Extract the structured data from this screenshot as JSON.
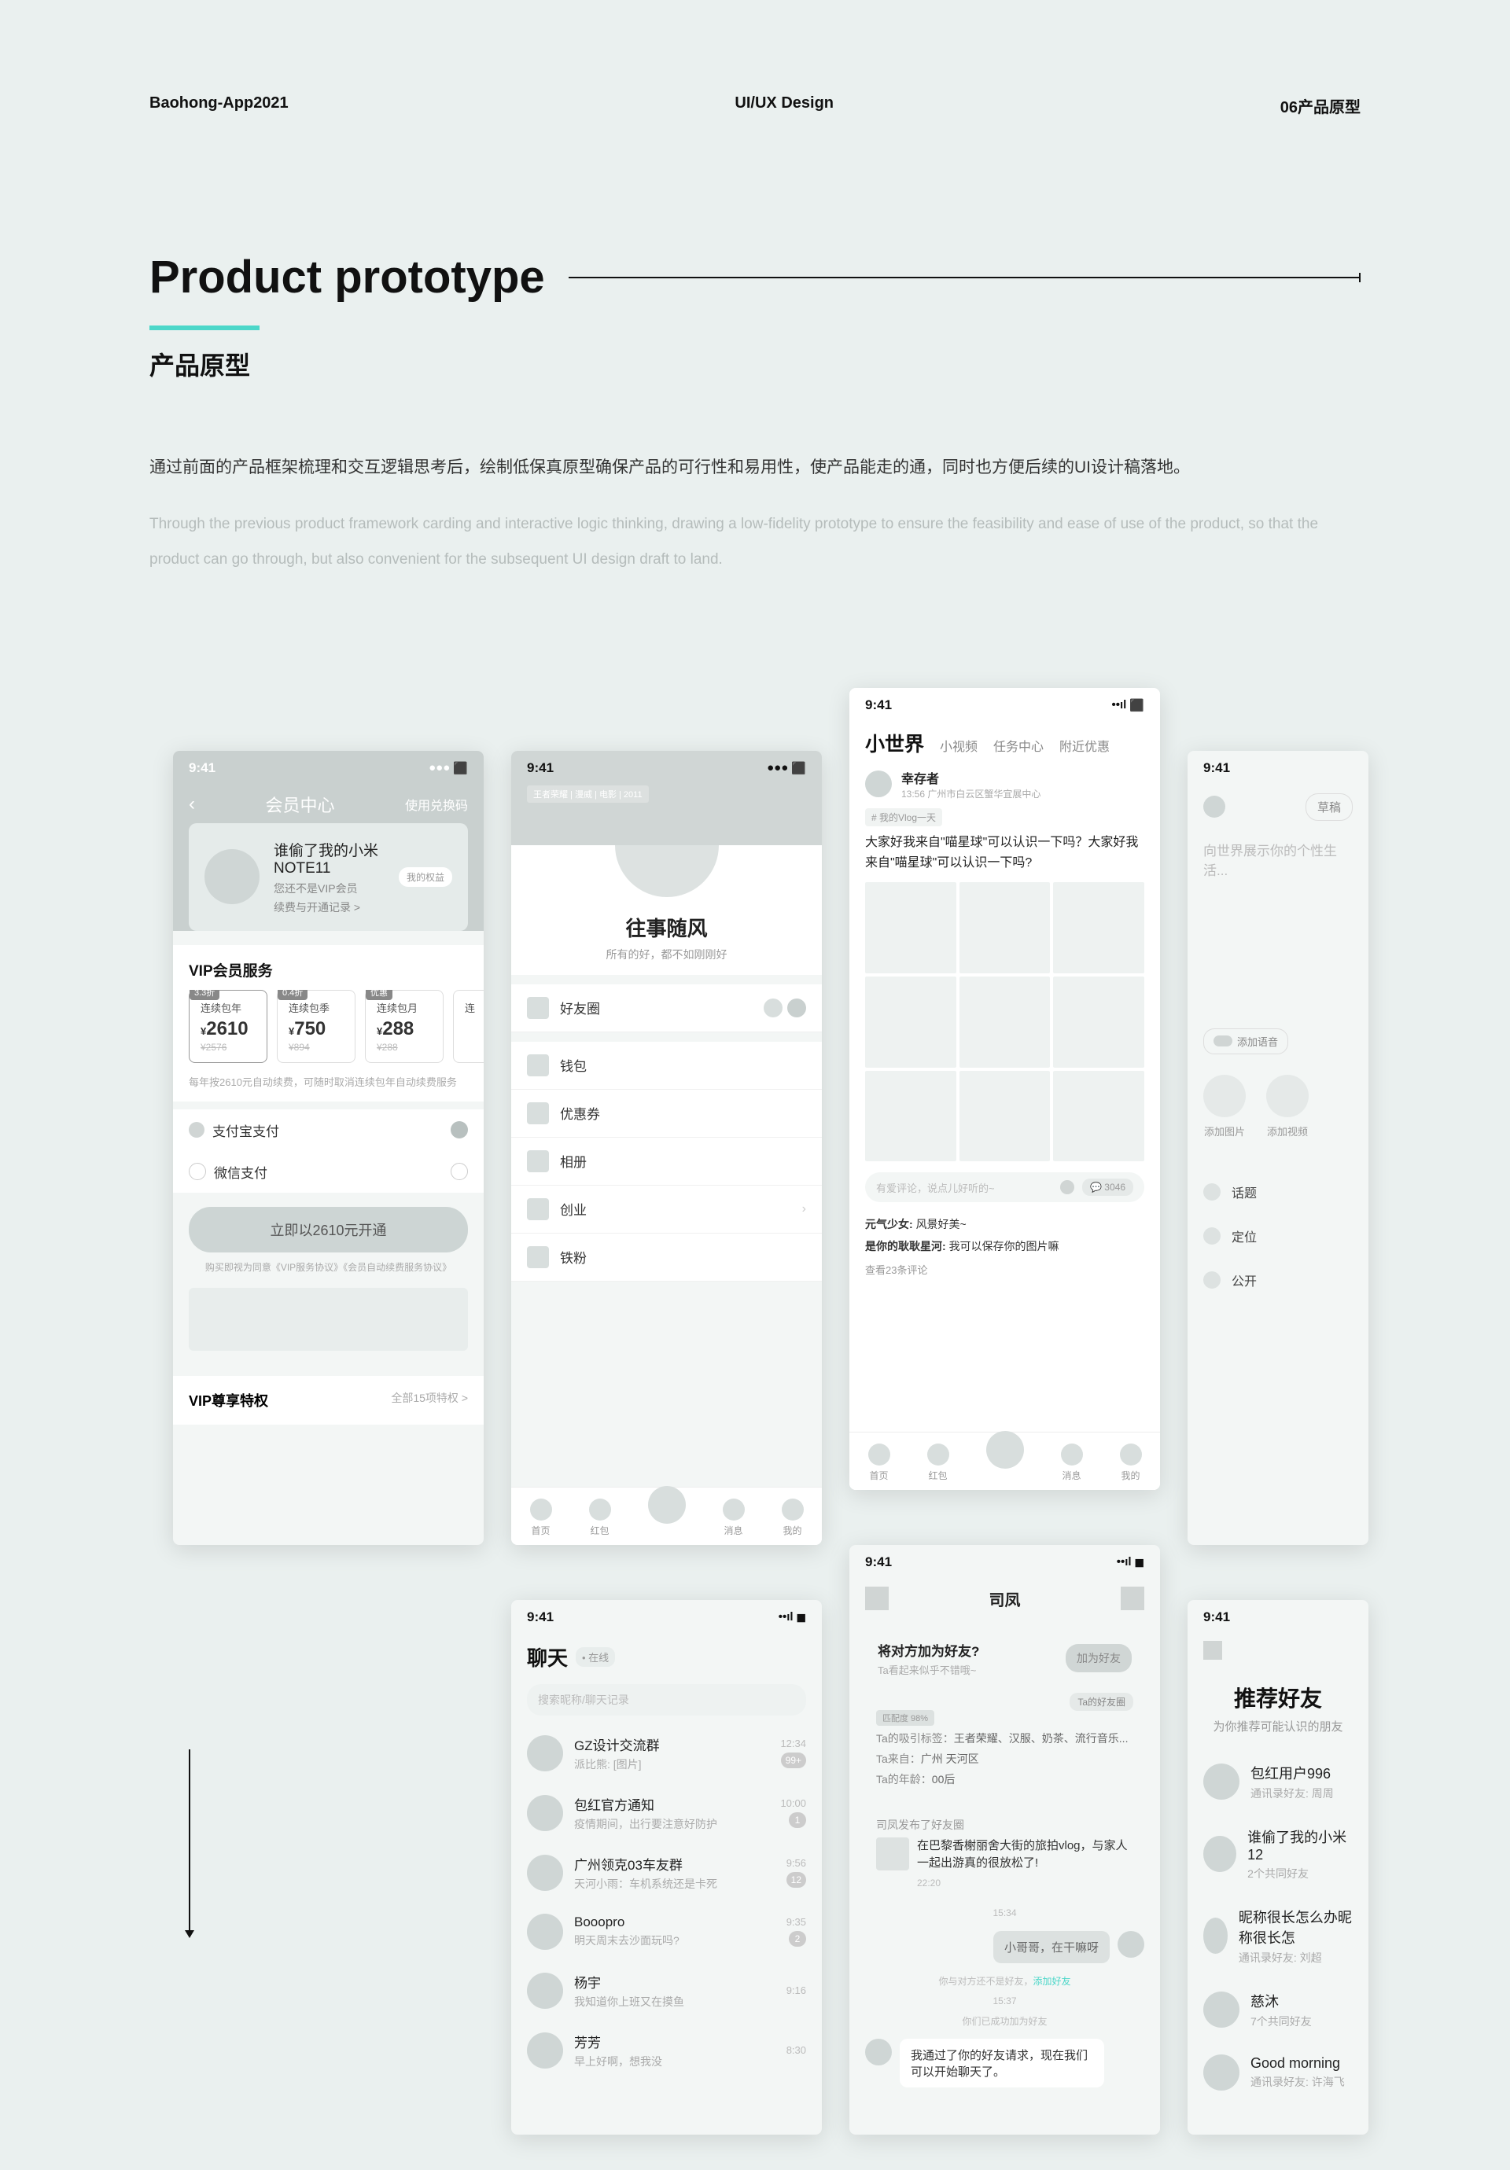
{
  "header": {
    "left": "Baohong-App2021",
    "center": "UI/UX Design",
    "right": "06产品原型"
  },
  "title": "Product prototype",
  "subtitle": "产品原型",
  "desc_cn": "通过前面的产品框架梳理和交互逻辑思考后，绘制低保真原型确保产品的可行性和易用性，使产品能走的通，同时也方便后续的UI设计稿落地。",
  "desc_en": "Through the previous product framework carding and interactive logic thinking, drawing a low-fidelity prototype to ensure the feasibility and ease of use of the product, so that the product can go through, but also convenient for the subsequent UI design draft to land.",
  "time": "9:41",
  "vip": {
    "nav_title": "会员中心",
    "nav_right": "使用兑换码",
    "uname": "谁偷了我的小米NOTE11",
    "usub": "您还不是VIP会员",
    "ulink": "续费与开通记录 >",
    "pill": "我的权益",
    "section": "VIP会员服务",
    "plans": [
      {
        "tag": "3.3折",
        "name": "连续包年",
        "price": "2610",
        "old": "¥2576"
      },
      {
        "tag": "0.4折",
        "name": "连续包季",
        "price": "750",
        "old": "¥894"
      },
      {
        "tag": "优惠",
        "name": "连续包月",
        "price": "288",
        "old": "¥288"
      },
      {
        "tag": "",
        "name": "连",
        "price": "",
        "old": ""
      }
    ],
    "note": "每年按2610元自动续费，可随时取消连续包年自动续费服务",
    "pay1": "支付宝支付",
    "pay2": "微信支付",
    "btn": "立即以2610元开通",
    "agree": "购买即视为同意《VIP服务协议》《会员自动续费服务协议》",
    "priv": "VIP尊享特权",
    "priv_r": "全部15项特权 >"
  },
  "profile": {
    "tag": "王者荣耀 | 漫威 | 电影 | 2011",
    "name": "往事随风",
    "sub": "所有的好，都不如刚刚好",
    "menu": [
      "好友圈",
      "钱包",
      "优惠券",
      "相册",
      "创业",
      "铁粉"
    ],
    "tabs": [
      "首页",
      "红包",
      "",
      "消息",
      "我的"
    ]
  },
  "feed": {
    "nav": [
      "小世界",
      "小视频",
      "任务中心",
      "附近优惠"
    ],
    "author": "幸存者",
    "meta": "13:56  广州市白云区蟹华宜展中心",
    "tag": "# 我的Vlog一天",
    "text": "大家好我来自\"喵星球\"可以认识一下吗？大家好我来自\"喵星球\"可以认识一下吗?",
    "comment_ph": "有爱评论，说点儿好听的~",
    "comment_cnt": "3046",
    "c1_who": "元气少女:",
    "c1_txt": "风景好美~",
    "c2_who": "是你的耿耿星河:",
    "c2_txt": "我可以保存你的图片嘛",
    "more": "查看23条评论",
    "tabs": [
      "首页",
      "红包",
      "",
      "消息",
      "我的"
    ]
  },
  "compose": {
    "draft": "草稿",
    "ph": "向世界展示你的个性生活...",
    "voice": "添加语音",
    "add1": "添加图片",
    "add2": "添加视频",
    "opts": [
      "话题",
      "定位",
      "公开"
    ]
  },
  "chat": {
    "title": "聊天",
    "status": "• 在线",
    "search_ph": "搜索昵称/聊天记录",
    "items": [
      {
        "nm": "GZ设计交流群",
        "sub": "派比熊: [图片]",
        "tm": "12:34",
        "bd": "99+"
      },
      {
        "nm": "包红官方通知",
        "sub": "疫情期间，出行要注意好防护",
        "tm": "10:00",
        "bd": "1"
      },
      {
        "nm": "广州领克03车友群",
        "sub": "天河小雨：车机系统还是卡死",
        "tm": "9:56",
        "bd": "12"
      },
      {
        "nm": "Booopro",
        "sub": "明天周末去沙面玩吗?",
        "tm": "9:35",
        "bd": "2"
      },
      {
        "nm": "杨宇",
        "sub": "我知道你上班又在摸鱼",
        "tm": "9:16",
        "bd": ""
      },
      {
        "nm": "芳芳",
        "sub": "早上好啊，想我没",
        "tm": "8:30",
        "bd": ""
      }
    ]
  },
  "dialog": {
    "title": "司凤",
    "add_t": "将对方加为好友?",
    "add_s": "Ta看起来似乎不错哦~",
    "add_btn": "加为好友",
    "match": "匹配度 98%",
    "pil": "Ta的好友圈",
    "r1_l": "Ta的吸引标签：",
    "r1_v": "王者荣耀、汉服、奶茶、流行音乐...",
    "r2_l": "Ta来自：",
    "r2_v": "广州 天河区",
    "r3_l": "Ta的年龄：",
    "r3_v": "00后",
    "card_t": "司凤发布了好友圈",
    "card_c": "在巴黎香榭丽舍大街的旅拍vlog，与家人一起出游真的很放松了!",
    "card_tm": "22:20",
    "tm1": "15:34",
    "bub1": "小哥哥，在干嘛呀",
    "sys1_a": "你与对方还不是好友，",
    "sys1_b": "添加好友",
    "tm2": "15:37",
    "sys2": "你们已成功加为好友",
    "msg": "我通过了你的好友请求，现在我们可以开始聊天了。"
  },
  "rec": {
    "title": "推荐好友",
    "sub": "为你推荐可能认识的朋友",
    "items": [
      {
        "nm": "包红用户996",
        "sub": "通讯录好友: 周周"
      },
      {
        "nm": "谁偷了我的小米12",
        "sub": "2个共同好友"
      },
      {
        "nm": "昵称很长怎么办昵称很长怎",
        "sub": "通讯录好友: 刘超"
      },
      {
        "nm": "慈沐",
        "sub": "7个共同好友"
      },
      {
        "nm": "Good morning",
        "sub": "通讯录好友: 许海飞"
      }
    ]
  }
}
